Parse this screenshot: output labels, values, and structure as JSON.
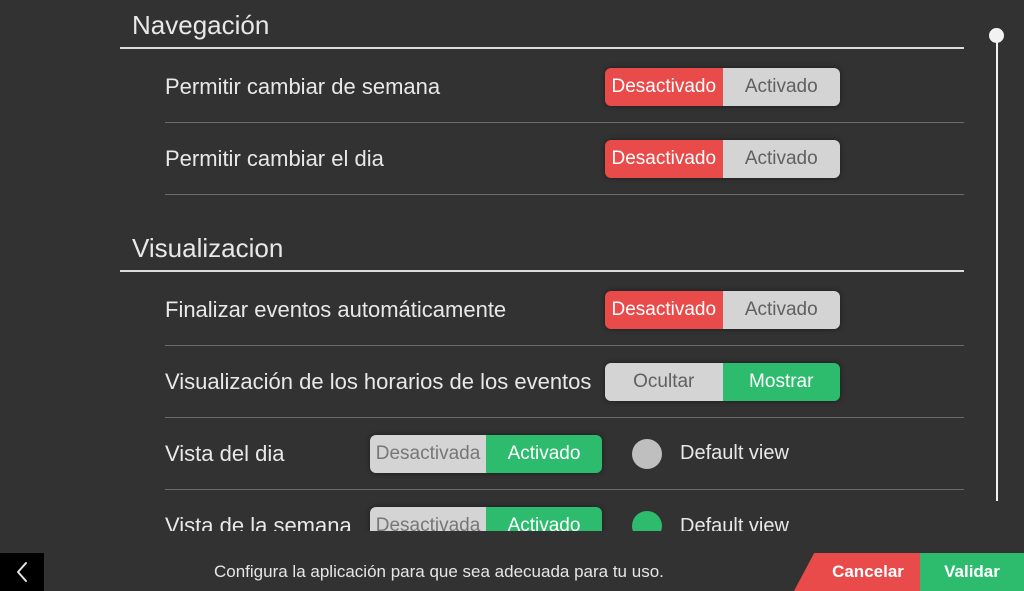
{
  "sections": {
    "navigation": {
      "title": "Navegación",
      "rows": {
        "allow_week": {
          "label": "Permitir cambiar de semana",
          "off": "Desactivado",
          "on": "Activado"
        },
        "allow_day": {
          "label": "Permitir cambiar el dia",
          "off": "Desactivado",
          "on": "Activado"
        }
      }
    },
    "visualization": {
      "title": "Visualizacion",
      "rows": {
        "auto_end": {
          "label": "Finalizar eventos automáticamente",
          "off": "Desactivado",
          "on": "Activado"
        },
        "event_times": {
          "label": "Visualización de los horarios de los eventos",
          "off": "Ocultar",
          "on": "Mostrar"
        },
        "day_view": {
          "label": "Vista del dia",
          "off": "Desactivada",
          "on": "Activado",
          "default_label": "Default view"
        },
        "week_view": {
          "label": "Vista de la semana",
          "off": "Desactivada",
          "on": "Activado",
          "default_label": "Default view"
        }
      }
    }
  },
  "footer": {
    "hint": "Configura la aplicación para que sea adecuada para tu uso.",
    "cancel": "Cancelar",
    "validate": "Validar"
  }
}
